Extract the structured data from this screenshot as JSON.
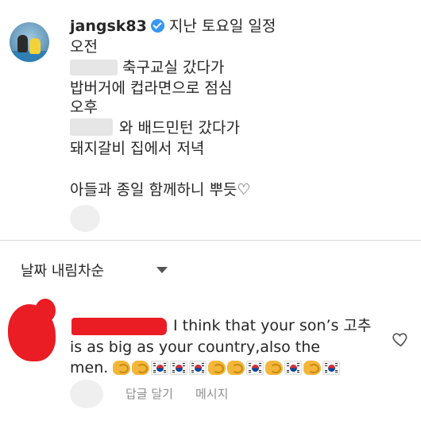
{
  "post": {
    "username": "jangsk83",
    "title": "지난 토요일 일정",
    "lines": [
      "오전",
      "축구교실 갔다가",
      "밥버거에 컵라면으로 점심",
      "오후",
      "와 배드민턴 갔다가",
      "돼지갈비 집에서 저녁",
      "아들과 종일 함께하니 뿌듯♡"
    ]
  },
  "sort": {
    "label": "날짜 내림차순"
  },
  "comment": {
    "line1": "I think that your son’s 고추",
    "line2": "is as big as your country,also the",
    "line3": "men.",
    "emojis": [
      "ok-hand",
      "ok-hand",
      "kr-flag",
      "kr-flag",
      "kr-flag",
      "ok-hand",
      "ok-hand",
      "kr-flag",
      "ok-hand",
      "kr-flag",
      "ok-hand",
      "kr-flag"
    ],
    "actions": {
      "reply": "답글 달기",
      "message": "메시지"
    }
  },
  "colors": {
    "verified": "#3897f0",
    "redaction": "#ea1c24",
    "muted": "#8e8e8e"
  }
}
